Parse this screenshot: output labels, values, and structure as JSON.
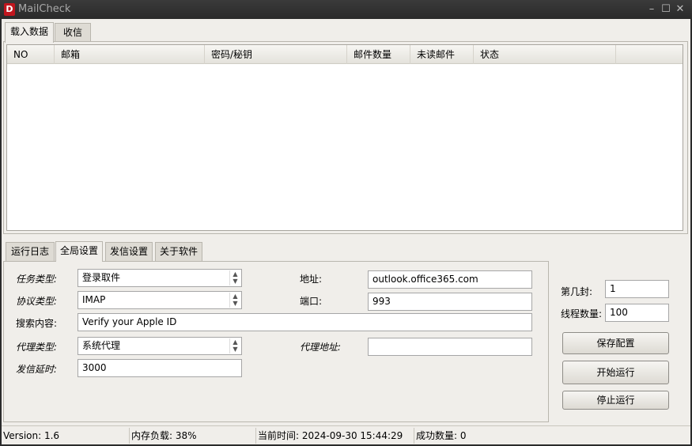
{
  "window": {
    "logo_letter": "D",
    "title": "MailCheck",
    "minimize_glyph": "–",
    "maximize_glyph": "☐",
    "close_glyph": "✕"
  },
  "top_tabs": [
    {
      "label": "载入数据",
      "active": true
    },
    {
      "label": "收信",
      "active": false
    }
  ],
  "grid": {
    "columns": [
      "NO",
      "邮箱",
      "密码/秘钥",
      "邮件数量",
      "未读邮件",
      "状态"
    ],
    "rows": []
  },
  "bottom_tabs": [
    {
      "label": "运行日志",
      "active": false
    },
    {
      "label": "全局设置",
      "active": true
    },
    {
      "label": "发信设置",
      "active": false
    },
    {
      "label": "关于软件",
      "active": false
    }
  ],
  "settings": {
    "task_type_label": "任务类型:",
    "task_type_value": "登录取件",
    "protocol_label": "协议类型:",
    "protocol_value": "IMAP",
    "search_label": "搜索内容:",
    "search_value": "Verify your Apple ID",
    "proxy_type_label": "代理类型:",
    "proxy_type_value": "系统代理",
    "send_delay_label": "发信延时:",
    "send_delay_value": "3000",
    "address_label": "地址:",
    "address_value": "outlook.office365.com",
    "port_label": "端口:",
    "port_value": "993",
    "proxy_addr_label": "代理地址:",
    "proxy_addr_value": ""
  },
  "side": {
    "nth_label": "第几封:",
    "nth_value": "1",
    "threads_label": "线程数量:",
    "threads_value": "100",
    "save_label": "保存配置",
    "start_label": "开始运行",
    "stop_label": "停止运行"
  },
  "status": {
    "version": "Version:  1.6",
    "memory": "内存负载:  38%",
    "time": "当前时间:  2024-09-30 15:44:29",
    "success": "成功数量:  0"
  }
}
